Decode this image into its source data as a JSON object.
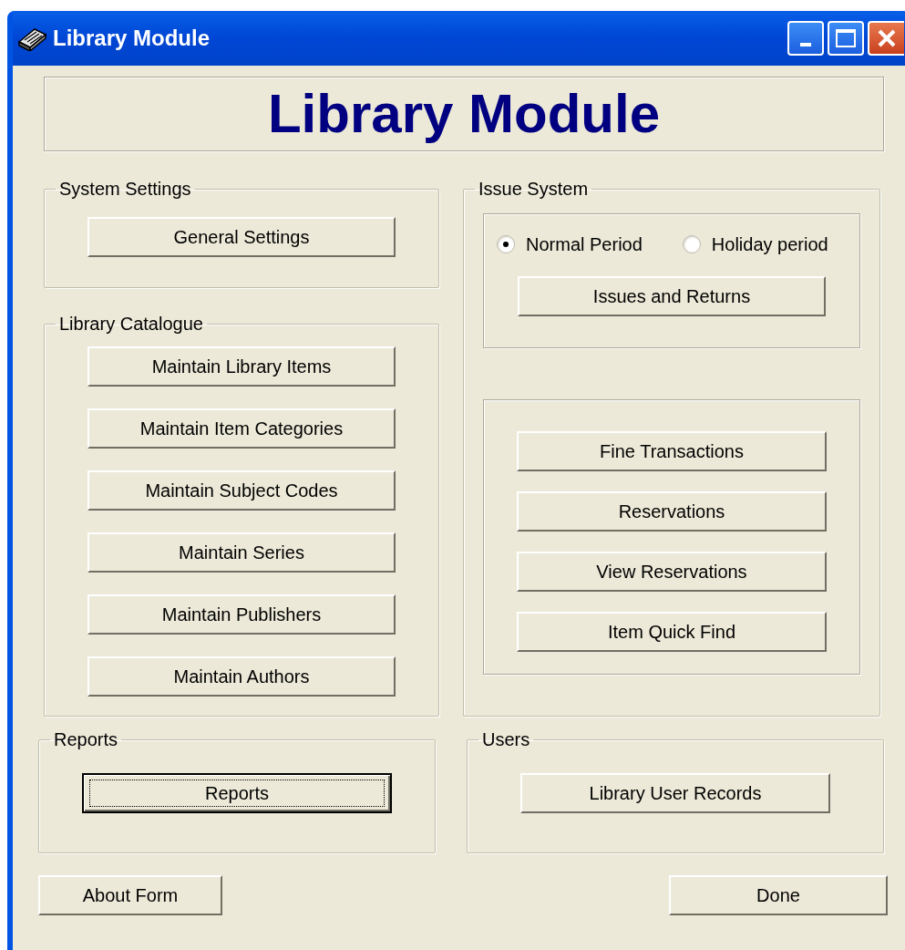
{
  "window": {
    "title": "Library Module"
  },
  "header": {
    "title": "Library Module"
  },
  "system_settings": {
    "legend": "System Settings",
    "buttons": [
      {
        "label": "General Settings",
        "focused": false
      }
    ]
  },
  "library_catalogue": {
    "legend": "Library Catalogue",
    "buttons": [
      {
        "label": "Maintain Library Items",
        "focused": false
      },
      {
        "label": "Maintain Item Categories",
        "focused": false
      },
      {
        "label": "Maintain Subject Codes",
        "focused": false
      },
      {
        "label": "Maintain Series",
        "focused": false
      },
      {
        "label": "Maintain Publishers",
        "focused": false
      },
      {
        "label": "Maintain Authors",
        "focused": false
      }
    ]
  },
  "issue_system": {
    "legend": "Issue System",
    "radios": [
      {
        "label": "Normal Period",
        "selected": true
      },
      {
        "label": "Holiday period",
        "selected": false
      }
    ],
    "buttons": [
      {
        "label": "Issues and Returns",
        "focused": false
      }
    ],
    "other_buttons": [
      {
        "label": "Fine Transactions",
        "focused": false
      },
      {
        "label": "Reservations",
        "focused": false
      },
      {
        "label": "View Reservations",
        "focused": false
      },
      {
        "label": "Item Quick Find",
        "focused": false
      }
    ]
  },
  "reports": {
    "legend": "Reports",
    "buttons": [
      {
        "label": "Reports",
        "focused": true
      }
    ]
  },
  "users": {
    "legend": "Users",
    "buttons": [
      {
        "label": "Library User Records",
        "focused": false
      }
    ]
  },
  "footer_buttons": [
    {
      "label": "About Form",
      "focused": false
    },
    {
      "label": "Done",
      "focused": false
    }
  ]
}
